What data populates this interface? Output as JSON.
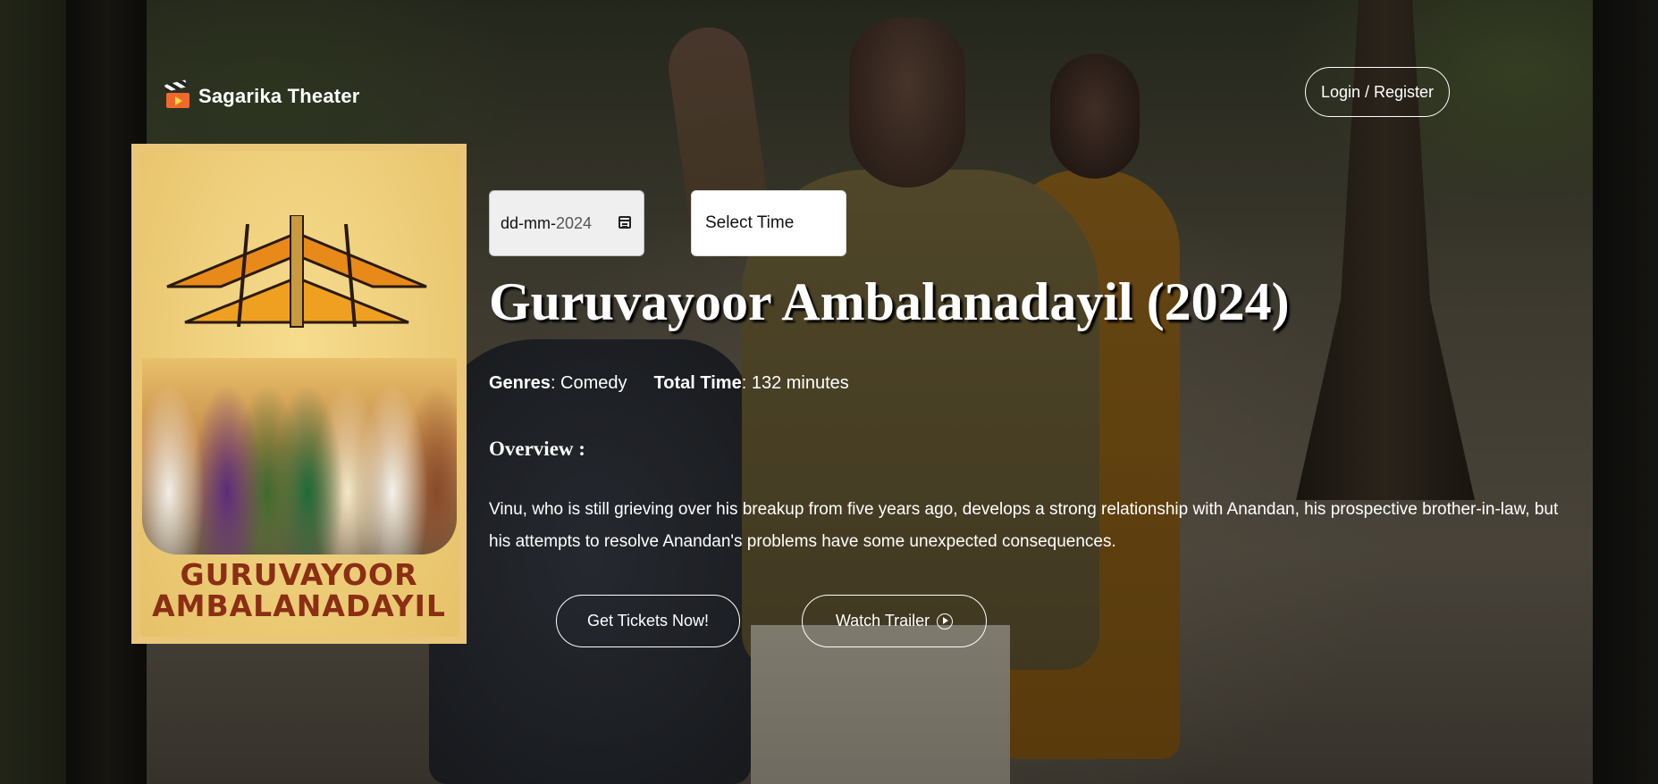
{
  "brand": {
    "name": "Sagarika Theater",
    "icon": "clapperboard-icon"
  },
  "header": {
    "login_label": "Login / Register"
  },
  "poster": {
    "title_line1": "GURUVAYOOR",
    "title_line2": "AMBALANADAYIL"
  },
  "booking": {
    "date_placeholder_prefix": "dd-mm-",
    "date_placeholder_year": "2024",
    "time_label": "Select Time"
  },
  "movie": {
    "title": "Guruvayoor Ambalanadayil (2024)",
    "genres_label": "Genres",
    "genres_value": ": Comedy",
    "time_label": "Total Time",
    "time_value": ": 132 minutes",
    "overview_heading": "Overview :",
    "overview": "Vinu, who is still grieving over his breakup from five years ago, develops a strong relationship with Anandan, his prospective brother-in-law, but his attempts to resolve Anandan's problems have some unexpected consequences."
  },
  "actions": {
    "tickets_label": "Get Tickets Now!",
    "trailer_label": "Watch Trailer"
  }
}
